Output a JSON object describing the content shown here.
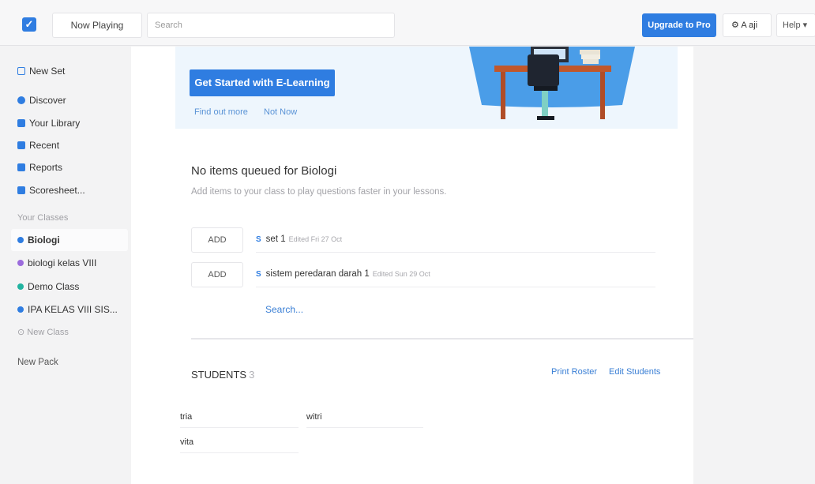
{
  "topbar": {
    "now_playing": "Now Playing",
    "search_placeholder": "Search",
    "upgrade": "Upgrade to Pro",
    "user": "A aji",
    "help": "Help ▾"
  },
  "sidebar": {
    "items": [
      {
        "label": "New Set",
        "icon": "new-set-icon",
        "color": "#2f7de1"
      },
      {
        "label": "Discover",
        "icon": "discover-icon",
        "color": "#2f7de1"
      },
      {
        "label": "Your Library",
        "icon": "library-icon",
        "color": "#2f7de1"
      },
      {
        "label": "Recent",
        "icon": "recent-icon",
        "color": "#2f7de1"
      },
      {
        "label": "Reports",
        "icon": "reports-icon",
        "color": "#2f7de1"
      },
      {
        "label": "Scoresheet...",
        "icon": "scoresheet-icon",
        "color": "#2f7de1"
      }
    ],
    "classes_label": "Your Classes",
    "classes": [
      {
        "label": "Biologi",
        "color": "#2f7de1"
      },
      {
        "label": "biologi kelas VIII",
        "color": "#9b6bdc"
      },
      {
        "label": "Demo Class",
        "color": "#21b3a0"
      },
      {
        "label": "IPA KELAS VIII SIS...",
        "color": "#2f7de1"
      }
    ],
    "new_class": "⊙ New Class",
    "new_pack": "New Pack"
  },
  "banner": {
    "button": "Get Started with E-Learning",
    "find_out": "Find out more",
    "not_now": "Not Now"
  },
  "queue": {
    "title": "No items queued for Biologi",
    "subtitle": "Add items to your class to play questions faster in your lessons.",
    "add_label": "ADD",
    "sets": [
      {
        "icon": "S",
        "name": "set 1",
        "edited": "Edited Fri 27 Oct"
      },
      {
        "icon": "S",
        "name": "sistem peredaran darah 1",
        "edited": "Edited Sun 29 Oct"
      }
    ],
    "search_link": "Search..."
  },
  "students": {
    "title": "STUDENTS",
    "count": "3",
    "print_roster": "Print Roster",
    "edit_students": "Edit Students",
    "names": [
      "tria",
      "witri",
      "vita"
    ]
  },
  "colors": {
    "accent": "#2f7de1",
    "banner_bg": "#eef6fd"
  }
}
